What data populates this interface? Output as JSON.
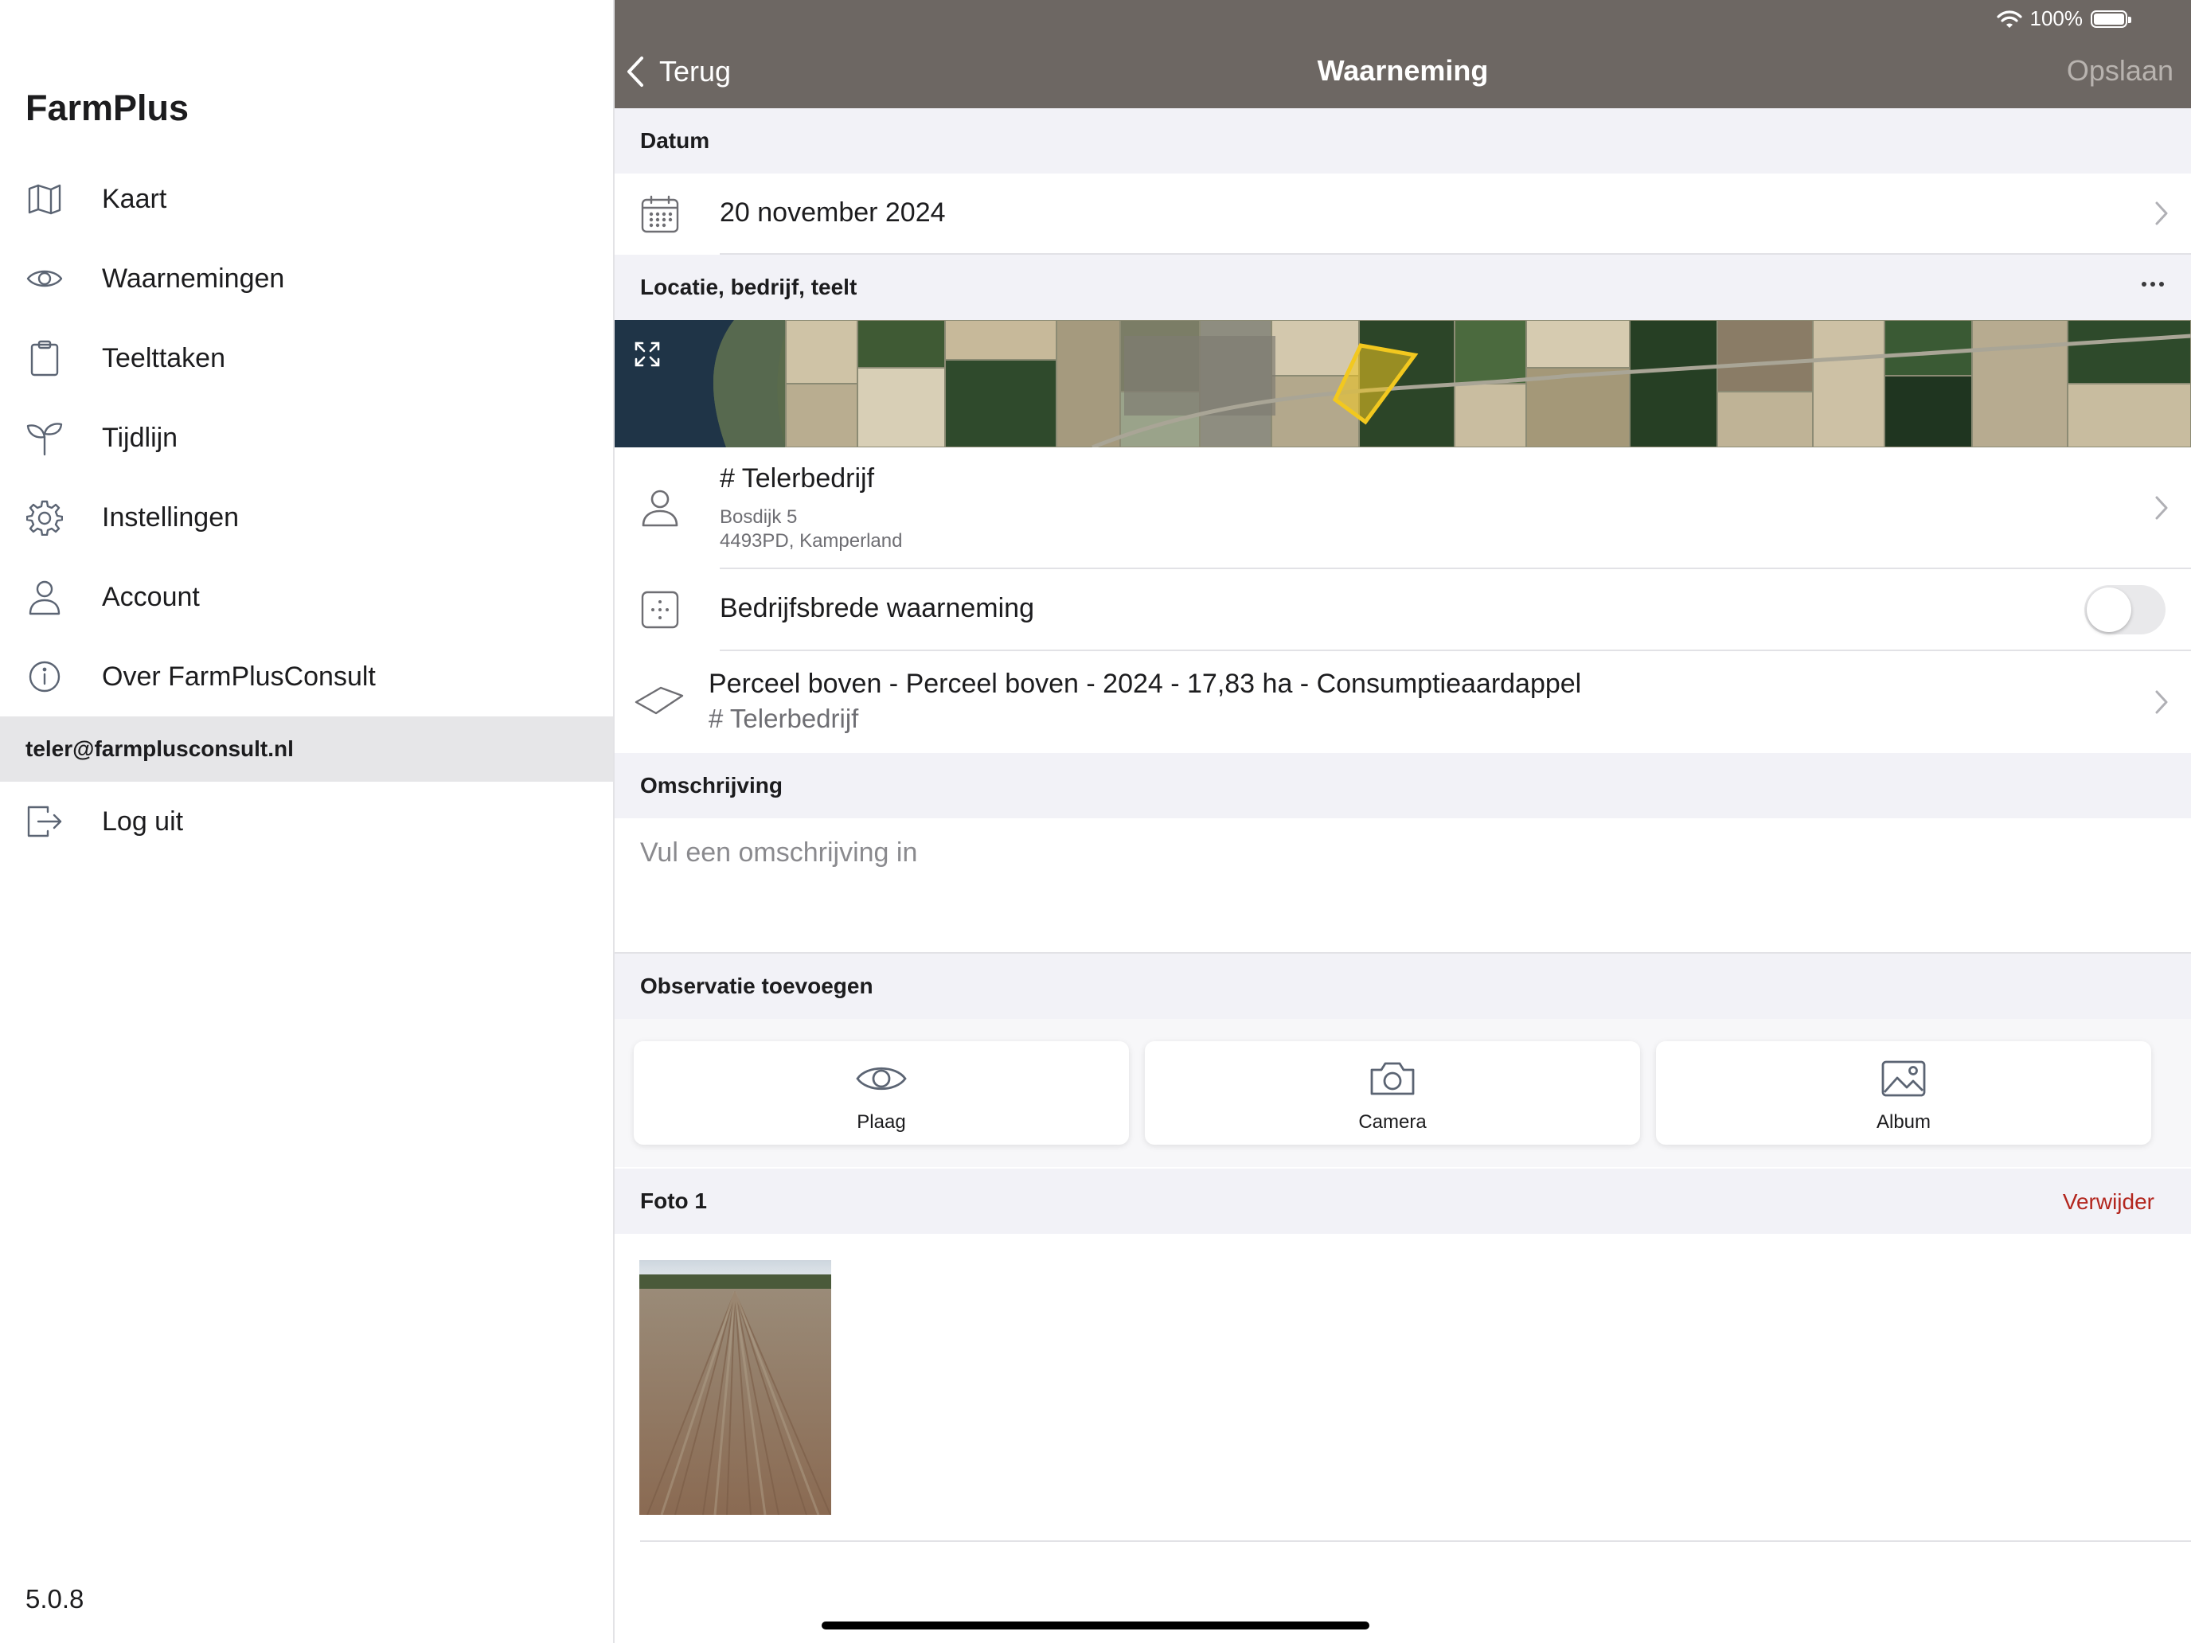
{
  "sidebar": {
    "brand": "FarmPlus",
    "items": [
      {
        "label": "Kaart",
        "icon": "map-icon"
      },
      {
        "label": "Waarnemingen",
        "icon": "eye-icon"
      },
      {
        "label": "Teelttaken",
        "icon": "clipboard-icon"
      },
      {
        "label": "Tijdlijn",
        "icon": "sprout-icon"
      },
      {
        "label": "Instellingen",
        "icon": "gear-icon"
      },
      {
        "label": "Account",
        "icon": "person-icon"
      },
      {
        "label": "Over FarmPlusConsult",
        "icon": "info-icon"
      }
    ],
    "user_email": "teler@farmplusconsult.nl",
    "logout_label": "Log uit",
    "version": "5.0.8"
  },
  "status_bar": {
    "battery_text": "100%"
  },
  "nav": {
    "back_label": "Terug",
    "title": "Waarneming",
    "save_label": "Opslaan"
  },
  "sections": {
    "date_header": "Datum",
    "location_header": "Locatie, bedrijf, teelt",
    "description_header": "Omschrijving",
    "observation_header": "Observatie toevoegen",
    "photo_header": "Foto 1"
  },
  "date_row": {
    "value": "20 november 2024"
  },
  "company_row": {
    "name": "# Telerbedrijf",
    "address_line1": "Bosdijk 5",
    "address_line2": "4493PD, Kamperland"
  },
  "company_wide_row": {
    "label": "Bedrijfsbrede waarneming",
    "toggle_on": false
  },
  "parcel_row": {
    "title": "Perceel boven - Perceel boven - 2024 - 17,83 ha - Consumptieaardappel",
    "subtitle": "# Telerbedrijf"
  },
  "description": {
    "placeholder": "Vul een omschrijving in"
  },
  "observation_buttons": [
    {
      "label": "Plaag",
      "icon": "eye-icon"
    },
    {
      "label": "Camera",
      "icon": "camera-icon"
    },
    {
      "label": "Album",
      "icon": "image-icon"
    }
  ],
  "photo": {
    "delete_label": "Verwijder"
  },
  "colors": {
    "navbar": "#6d6763",
    "section_bg": "#f2f2f7",
    "delete_red": "#b3261e",
    "parcel_highlight": "#f2c81f"
  }
}
